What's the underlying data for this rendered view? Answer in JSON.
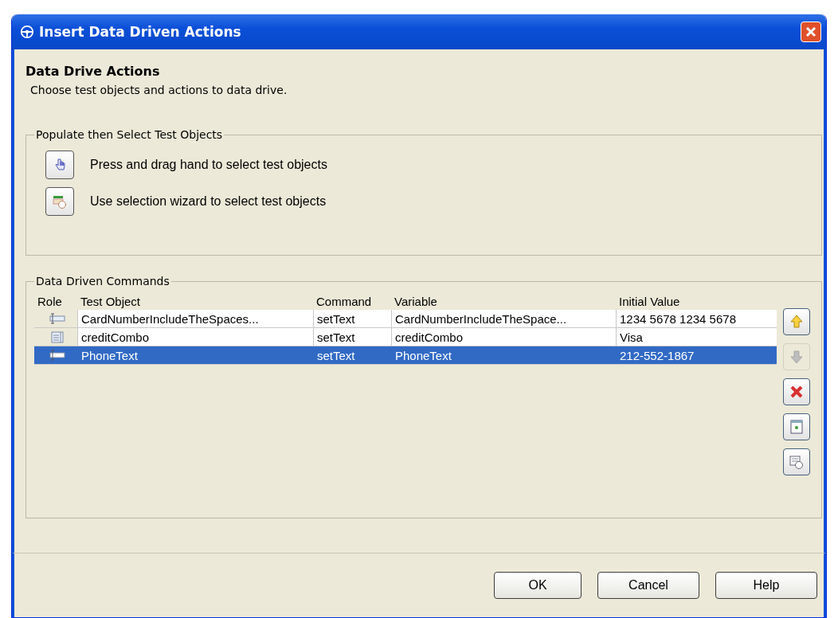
{
  "window": {
    "title": "Insert Data Driven Actions"
  },
  "header": {
    "title": "Data Drive Actions",
    "subtitle": "Choose test objects and actions to data drive."
  },
  "populate": {
    "legend": "Populate then Select Test Objects",
    "options": [
      {
        "kind": "hand",
        "label": "Press and drag hand to select test objects"
      },
      {
        "kind": "wizard",
        "label": "Use selection wizard to select test objects"
      }
    ]
  },
  "commands": {
    "legend": "Data Driven Commands",
    "columns": [
      "Role",
      "Test Object",
      "Command",
      "Variable",
      "Initial Value"
    ],
    "rows": [
      {
        "kind": "textfield",
        "test_object": "CardNumberIncludeTheSpaces...",
        "command": "setText",
        "variable": "CardNumberIncludeTheSpace...",
        "initial_value": "1234 5678 1234 5678",
        "selected": false
      },
      {
        "kind": "combo",
        "test_object": "creditCombo",
        "command": "setText",
        "variable": "creditCombo",
        "initial_value": "Visa",
        "selected": false
      },
      {
        "kind": "textfield",
        "test_object": "PhoneText",
        "command": "setText",
        "variable": "PhoneText",
        "initial_value": "212-552-1867",
        "selected": true
      }
    ],
    "side_buttons": [
      {
        "kind": "up",
        "disabled": false
      },
      {
        "kind": "down",
        "disabled": true
      },
      {
        "kind": "delete",
        "disabled": false
      },
      {
        "kind": "datapool",
        "disabled": false
      },
      {
        "kind": "wizard",
        "disabled": false
      }
    ]
  },
  "buttons": [
    "OK",
    "Cancel",
    "Help"
  ]
}
